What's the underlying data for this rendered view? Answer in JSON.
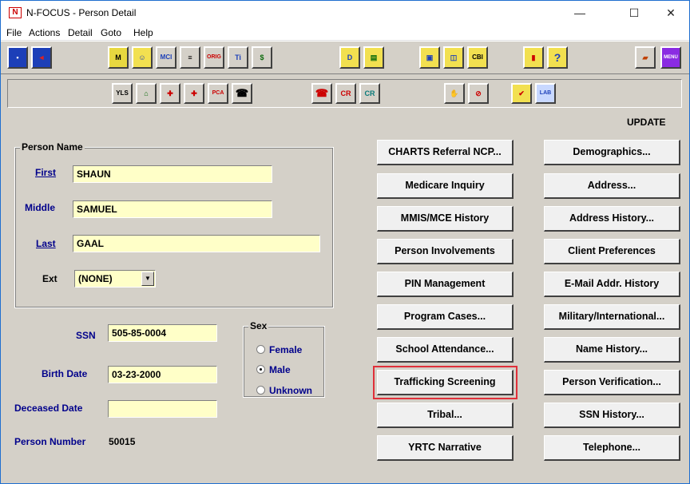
{
  "window": {
    "title": "N-FOCUS - Person Detail",
    "app_icon": "N",
    "minimize": "—",
    "maximize": "☐",
    "close": "✕"
  },
  "menu": [
    "File",
    "Actions",
    "Detail",
    "Goto",
    "Help"
  ],
  "toolbar1_icons": [
    {
      "name": "exit-icon",
      "glyph": "▪"
    },
    {
      "name": "back-icon",
      "glyph": "◄"
    },
    {
      "name": "m-icon",
      "glyph": "M"
    },
    {
      "name": "person-icon",
      "glyph": "☺"
    },
    {
      "name": "mci-icon",
      "glyph": "MCI"
    },
    {
      "name": "notepad-icon",
      "glyph": "≡"
    },
    {
      "name": "orig-icon",
      "glyph": "ORIG"
    },
    {
      "name": "ti-icon",
      "glyph": "Ti"
    },
    {
      "name": "method-icon",
      "glyph": "$"
    },
    {
      "name": "d-icon",
      "glyph": "D"
    },
    {
      "name": "document-icon",
      "glyph": "▤"
    },
    {
      "name": "window-icon",
      "glyph": "▣"
    },
    {
      "name": "copy-window-icon",
      "glyph": "◫"
    },
    {
      "name": "cbi-icon",
      "glyph": "CBI"
    },
    {
      "name": "chart-icon",
      "glyph": "▮"
    },
    {
      "name": "help-icon",
      "glyph": "?"
    },
    {
      "name": "folder-icon",
      "glyph": "▰"
    },
    {
      "name": "menu-icon",
      "glyph": "MENU"
    }
  ],
  "toolbar2_icons": [
    {
      "name": "yls-icon",
      "glyph": "YLS"
    },
    {
      "name": "house-person-icon",
      "glyph": "⌂"
    },
    {
      "name": "medical-check-icon",
      "glyph": "✚"
    },
    {
      "name": "medical-doc-icon",
      "glyph": "✚"
    },
    {
      "name": "pca-icon",
      "glyph": "PCA"
    },
    {
      "name": "phone-icon",
      "glyph": "☎"
    },
    {
      "name": "phone-red-icon",
      "glyph": "☎"
    },
    {
      "name": "cr-red-icon",
      "glyph": "CR"
    },
    {
      "name": "cr-teal-icon",
      "glyph": "CR"
    },
    {
      "name": "handshake-icon",
      "glyph": "✋"
    },
    {
      "name": "no-edit-icon",
      "glyph": "⊘"
    },
    {
      "name": "checklist-icon",
      "glyph": "✔"
    },
    {
      "name": "lab-icon",
      "glyph": "LAB"
    }
  ],
  "status": "UPDATE",
  "person_name": {
    "legend": "Person Name",
    "first_label": "First",
    "first_value": "SHAUN",
    "middle_label": "Middle",
    "middle_value": "SAMUEL",
    "last_label": "Last",
    "last_value": "GAAL",
    "ext_label": "Ext",
    "ext_value": "(NONE)"
  },
  "ssn_label": "SSN",
  "ssn_value": "505-85-0004",
  "birth_label": "Birth Date",
  "birth_value": "03-23-2000",
  "deceased_label": "Deceased Date",
  "deceased_value": "",
  "person_number_label": "Person Number",
  "person_number_value": "50015",
  "sex": {
    "legend": "Sex",
    "options": [
      "Female",
      "Male",
      "Unknown"
    ],
    "selected": "Male"
  },
  "buttons_mid": [
    "CHARTS Referral NCP...",
    "Medicare Inquiry",
    "MMIS/MCE History",
    "Person Involvements",
    "PIN Management",
    "Program Cases...",
    "School Attendance...",
    "Trafficking Screening",
    "Tribal...",
    "YRTC Narrative"
  ],
  "buttons_right": [
    "Demographics...",
    "Address...",
    "Address History...",
    "Client Preferences",
    "E-Mail Addr. History",
    "Military/International...",
    "Name History...",
    "Person Verification...",
    "SSN History...",
    "Telephone..."
  ]
}
